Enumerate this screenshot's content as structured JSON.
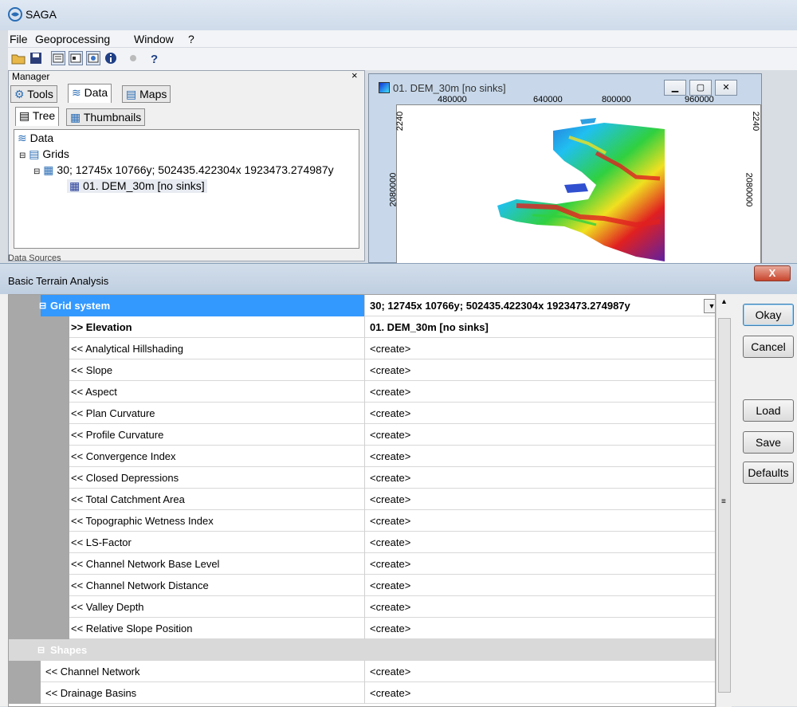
{
  "app": {
    "title": "SAGA"
  },
  "menu": [
    "File",
    "Geoprocessing",
    "Window",
    "?"
  ],
  "manager": {
    "title": "Manager",
    "tabs": [
      "Tools",
      "Data",
      "Maps"
    ],
    "subtabs": [
      "Tree",
      "Thumbnails"
    ],
    "tree": {
      "root": "Data",
      "grids": "Grids",
      "system": "30; 12745x 10766y; 502435.422304x 1923473.274987y",
      "item": "01. DEM_30m [no sinks]"
    },
    "data_sources": "Data Sources"
  },
  "map_window": {
    "title": "01. DEM_30m [no sinks]",
    "x_ticks": [
      "480000",
      "640000",
      "800000",
      "960000"
    ],
    "y_ticks": [
      "2240",
      "2080000"
    ]
  },
  "dialog": {
    "title": "Basic Terrain Analysis",
    "close": "X",
    "buttons": {
      "okay": "Okay",
      "cancel": "Cancel",
      "load": "Load",
      "save": "Save",
      "defaults": "Defaults"
    },
    "grid_system": {
      "label": "Grid system",
      "value": "30; 12745x 10766y; 502435.422304x 1923473.274987y"
    },
    "elevation": {
      "label": ">> Elevation",
      "value": "01. DEM_30m [no sinks]"
    },
    "outputs": [
      {
        "label": "<< Analytical Hillshading",
        "value": "<create>"
      },
      {
        "label": "<< Slope",
        "value": "<create>"
      },
      {
        "label": "<< Aspect",
        "value": "<create>"
      },
      {
        "label": "<< Plan Curvature",
        "value": "<create>"
      },
      {
        "label": "<< Profile Curvature",
        "value": "<create>"
      },
      {
        "label": "<< Convergence Index",
        "value": "<create>"
      },
      {
        "label": "<< Closed Depressions",
        "value": "<create>"
      },
      {
        "label": "<< Total Catchment Area",
        "value": "<create>"
      },
      {
        "label": "<< Topographic Wetness Index",
        "value": "<create>"
      },
      {
        "label": "<< LS-Factor",
        "value": "<create>"
      },
      {
        "label": "<< Channel Network Base Level",
        "value": "<create>"
      },
      {
        "label": "<< Channel Network Distance",
        "value": "<create>"
      },
      {
        "label": "<< Valley Depth",
        "value": "<create>"
      },
      {
        "label": "<< Relative Slope Position",
        "value": "<create>"
      }
    ],
    "shapes": {
      "label": "Shapes"
    },
    "shape_outputs": [
      {
        "label": "<< Channel Network",
        "value": "<create>"
      },
      {
        "label": "<< Drainage Basins",
        "value": "<create>"
      }
    ]
  }
}
